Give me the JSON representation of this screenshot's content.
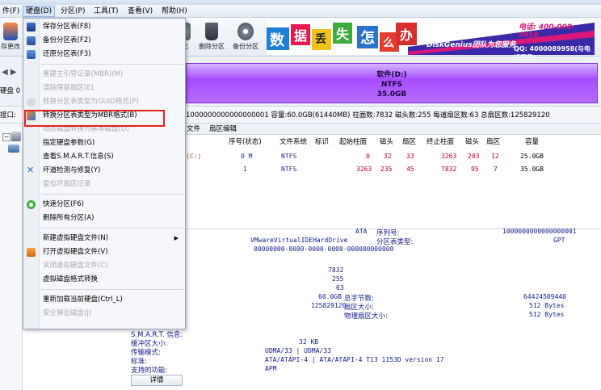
{
  "menubar": {
    "items": [
      {
        "label": "件(F)"
      },
      {
        "label": "硬盘(D)"
      },
      {
        "label": "分区(P)"
      },
      {
        "label": "工具(T)"
      },
      {
        "label": "查看(V)"
      },
      {
        "label": "帮助(H)"
      }
    ]
  },
  "toolbar": {
    "left_btn_label": "存更改",
    "buttons": [
      {
        "label": "化",
        "icon": "format-icon"
      },
      {
        "label": "删除分区",
        "icon": "delete-partition-icon"
      },
      {
        "label": "备份分区",
        "icon": "backup-partition-icon"
      }
    ]
  },
  "banner": {
    "tiles": [
      "数",
      "据",
      "丢",
      "失",
      "怎",
      "么",
      "办"
    ],
    "brand": "DiskGenius团队为您服务",
    "phone_label": "电话: 400-008-9958",
    "qq": "QQ: 4000089958(与电话同号)"
  },
  "disk_block": {
    "name": "软件(D:)",
    "fs": "NTFS",
    "size": "35.0GB"
  },
  "disk_info": {
    "prefix": "接口:",
    "text": "1000000000000000001  容量:60.0GB(61440MB)  柱面数:7832  磁头数:255  每道扇区数:63  总扇区数:125829120"
  },
  "left_labels": {
    "disk": "硬盘 0"
  },
  "tabs": [
    "文件",
    "扇区编辑"
  ],
  "partition_table": {
    "headers": [
      "序号(状态)",
      "文件系统",
      "标识",
      "起始柱面",
      "磁头",
      "扇区",
      "终止柱面",
      "磁头",
      "扇区",
      "容量"
    ],
    "rows": [
      {
        "name": "(C:)",
        "index": "0 M",
        "fs": "NTFS",
        "id": "",
        "start_cyl": "0",
        "start_head": "32",
        "start_sec": "33",
        "end_cyl": "3263",
        "end_head": "203",
        "end_sec": "12",
        "size": "25.0GB"
      },
      {
        "name": "",
        "index": "1",
        "fs": "NTFS",
        "id": "",
        "start_cyl": "3263",
        "start_head": "235",
        "start_sec": "45",
        "end_cyl": "7832",
        "end_head": "95",
        "end_sec": "7",
        "size": "35.0GB"
      }
    ]
  },
  "details": {
    "iface": "ATA",
    "model": "VMwareVirtualIDEHardDrive",
    "guid": "00000000-0000-0000-0000-000000000000",
    "serial_label": "序列号:",
    "ptype_label": "分区表类型:",
    "serial_value": "1000000000000000001",
    "ptype_value": "GPT",
    "cylinders": "7832",
    "heads": "255",
    "sectors": "63",
    "capacity": "60.0GB",
    "total_sectors": "125829120",
    "total_bytes_label": "总字节数:",
    "sector_size_label": "扇区大小:",
    "phys_sector_label": "物理扇区大小:",
    "total_bytes_value": "64424509440",
    "sector_size_value": "512 Bytes",
    "phys_sector_value": "512 Bytes",
    "smart_label": "S.M.A.R.T. 信息:",
    "buffer_label": "缓冲区大小:",
    "buffer_value": "32 KB",
    "transfer_label": "传输模式:",
    "transfer_value": "UDMA/33 | UDMA/33",
    "standard_label": "标准:",
    "standard_value": "ATA/ATAPI-4 | ATA/ATAPI-4 T13 1153D version 17",
    "features_label": "支持的功能:",
    "features_value": "APM",
    "details_button": "详情"
  },
  "dropdown": {
    "items": [
      {
        "label": "保存分区表(F8)",
        "disabled": false,
        "icon": "save-icon"
      },
      {
        "label": "备份分区表(F2)",
        "disabled": false,
        "icon": "backup-icon"
      },
      {
        "label": "还原分区表(F3)",
        "disabled": false,
        "icon": "restore-icon"
      },
      {
        "label": "重建主引导记录(MBR)(M)",
        "disabled": true,
        "icon": ""
      },
      {
        "label": "清除保留扇区(E)",
        "disabled": true,
        "icon": ""
      },
      {
        "label": "转换分区表类型为GUID格式(P)",
        "disabled": true,
        "icon": ""
      },
      {
        "label": "转换分区表类型为MBR格式(B)",
        "disabled": false,
        "icon": "convert-icon"
      },
      {
        "label": "动态磁盘转换为基本磁盘(D)",
        "disabled": true,
        "icon": ""
      },
      {
        "label": "指定硬盘参数(G)",
        "disabled": false,
        "icon": ""
      },
      {
        "label": "查看S.M.A.R.T.信息(S)",
        "disabled": false,
        "icon": ""
      },
      {
        "label": "坏道检测与修复(Y)",
        "disabled": false,
        "icon": "repair-icon"
      },
      {
        "label": "复位坏扇区记录",
        "disabled": true,
        "icon": ""
      },
      {
        "label": "快速分区(F6)",
        "disabled": false,
        "icon": "quick-partition-icon"
      },
      {
        "label": "删除所有分区(A)",
        "disabled": false,
        "icon": ""
      },
      {
        "label": "新建虚拟硬盘文件(N)",
        "disabled": false,
        "icon": "",
        "submenu": true
      },
      {
        "label": "打开虚拟硬盘文件(V)",
        "disabled": false,
        "icon": "open-vdisk-icon"
      },
      {
        "label": "关闭虚拟硬盘文件(C)",
        "disabled": true,
        "icon": ""
      },
      {
        "label": "虚拟磁盘格式转换",
        "disabled": false,
        "icon": ""
      },
      {
        "label": "重新加载当前硬盘(Ctrl_L)",
        "disabled": false,
        "icon": ""
      },
      {
        "label": "安全弹出磁盘(J)",
        "disabled": true,
        "icon": ""
      }
    ]
  },
  "colors": {
    "partition_purple": "#a64dff",
    "highlight_red": "#e2231a",
    "menu_bg": "#f6f7fa"
  }
}
